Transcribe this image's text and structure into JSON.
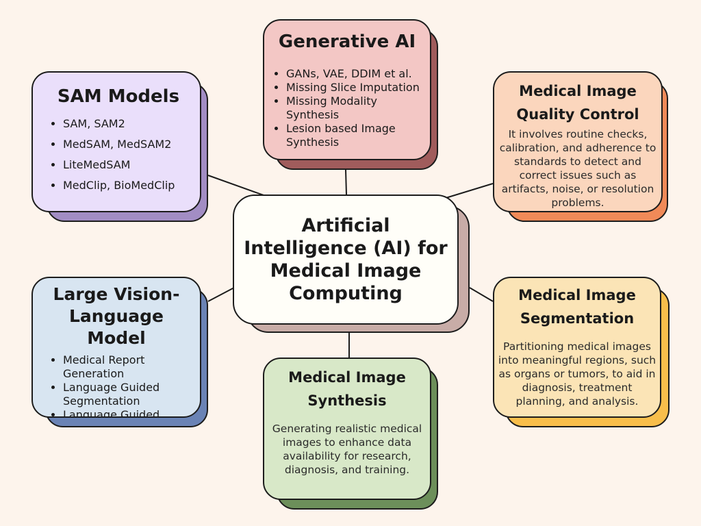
{
  "center": {
    "title": "Artificial Intelligence (AI) for Medical Image Computing"
  },
  "sam_models": {
    "title": "SAM Models",
    "items": [
      "SAM, SAM2",
      "MedSAM, MedSAM2",
      "LiteMedSAM",
      "MedClip, BioMedClip"
    ],
    "fill_color": "#eadffb",
    "shadow_color": "#a28dc4"
  },
  "generative_ai": {
    "title": "Generative AI",
    "items": [
      "GANs, VAE, DDIM et al.",
      "Missing Slice Imputation",
      "Missing Modality Synthesis",
      "Lesion based Image Synthesis"
    ],
    "fill_color": "#f3c7c5",
    "shadow_color": "#a05c5c"
  },
  "quality_control": {
    "title": "Medical Image Quality Control",
    "description": "It involves routine checks, calibration, and adherence to standards to detect and correct issues such as artifacts, noise, or resolution problems.",
    "fill_color": "#fbd6bd",
    "shadow_color": "#f08a58"
  },
  "lvlm": {
    "title": "Large Vision-Language Model",
    "items": [
      "Medical Report Generation",
      "Language Guided Segmentation",
      "Language Guided Image Generation"
    ],
    "fill_color": "#d8e5f1",
    "shadow_color": "#6a83b5"
  },
  "segmentation": {
    "title": "Medical Image Segmentation",
    "description": "Partitioning medical images into meaningful regions, such as organs or tumors, to aid in diagnosis, treatment planning, and analysis.",
    "fill_color": "#fbe4b6",
    "shadow_color": "#f8be4b"
  },
  "synthesis": {
    "title": "Medical Image Synthesis",
    "description": "Generating realistic medical images to enhance data availability for research, diagnosis, and training.",
    "fill_color": "#d8e8c8",
    "shadow_color": "#6c8f5a"
  }
}
